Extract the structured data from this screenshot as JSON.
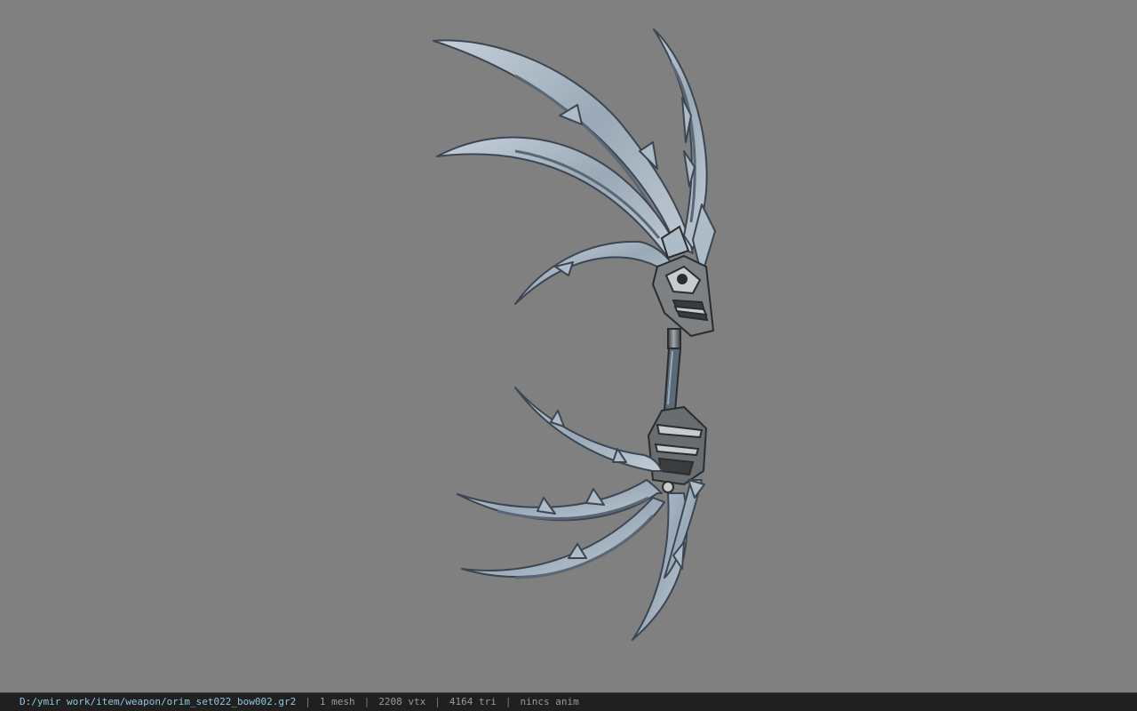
{
  "viewer": {
    "background_color": "#808080",
    "model_colors": {
      "blade_fill": "#aebcc8",
      "blade_edge": "#3c4652",
      "blade_inner": "#6f7c8a",
      "grip_fill": "#5a5d60",
      "grip_dark": "#2a2c2e",
      "grip_light": "#c9ccce"
    }
  },
  "statusbar": {
    "file_path": "D:/ymir work/item/weapon/orim_set022_bow002.gr2",
    "separator": "|",
    "mesh_count": "1 mesh",
    "vertex_count": "2208 vtx",
    "triangle_count": "4164 tri",
    "animation_status": "nincs anim"
  }
}
